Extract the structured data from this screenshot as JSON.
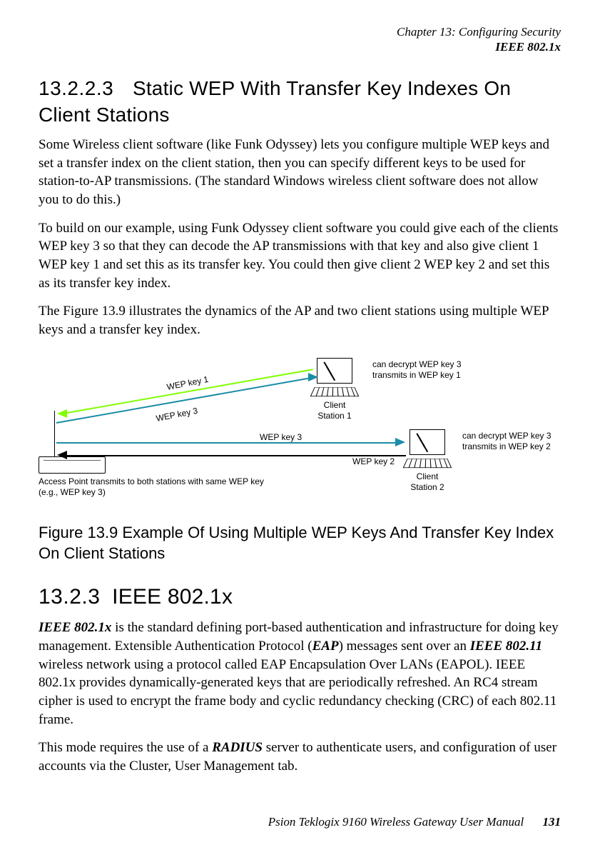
{
  "header": {
    "chapter": "Chapter 13:  Configuring Security",
    "section": "IEEE 802.1x"
  },
  "sec1": {
    "num": "13.2.2.3",
    "title": "Static WEP With Transfer Key Indexes On Client Stations"
  },
  "para1": "Some Wireless client software (like Funk Odyssey) lets you configure multiple WEP keys and set a transfer index on the client station, then you can specify different keys to be used for station-to-AP transmissions. (The standard Windows wireless client software does not allow you to do this.)",
  "para2": "To build on our example, using Funk Odyssey client software you could give each of the clients WEP key 3 so that they can decode the AP transmissions with that key and also give client 1 WEP key 1 and set this as its transfer key. You could then give client 2 WEP key 2 and set this as its transfer key index.",
  "para3": "The Figure 13.9 illustrates the dynamics of the AP and two client stations using multiple WEP keys and a transfer key index.",
  "figure": {
    "ap_caption_line1": "Access Point transmits to both stations with same WEP key",
    "ap_caption_line2": "(e.g., WEP key 3)",
    "client1_label": "Client Station 1",
    "client2_label": "Client Station 2",
    "client1_note_l1": "can decrypt WEP key 3",
    "client1_note_l2": "transmits in WEP key 1",
    "client2_note_l1": "can decrypt WEP key 3",
    "client2_note_l2": "transmits in WEP key 2",
    "labels": {
      "wep1": "WEP key 1",
      "wep3_a": "WEP key 3",
      "wep3_b": "WEP key 3",
      "wep2": "WEP key 2"
    },
    "caption": "Figure 13.9 Example Of Using Multiple WEP Keys And Transfer Key Index On Client Stations"
  },
  "sec2": {
    "num": "13.2.3",
    "title": "IEEE 802.1x"
  },
  "para4": {
    "t1": "IEEE 802.1x",
    "t2": " is the standard defining port-based authentication and infrastructure for doing key management. Extensible Authentication Protocol (",
    "t3": "EAP",
    "t4": ") messages sent over an ",
    "t5": "IEEE 802.11",
    "t6": " wireless network using a protocol called EAP Encapsulation Over LANs (EAPOL). IEEE 802.1x provides dynamically-generated keys that are periodically refreshed. An RC4 stream cipher is used to encrypt the frame body and cyclic redundancy checking (CRC) of each 802.11 frame."
  },
  "para5": {
    "t1": "This mode requires the use of a ",
    "t2": "RADIUS",
    "t3": " server to authenticate users, and configuration of user accounts via the Cluster, User Management tab."
  },
  "footer": {
    "manual": "Psion Teklogix 9160 Wireless Gateway User Manual",
    "page": "131"
  }
}
